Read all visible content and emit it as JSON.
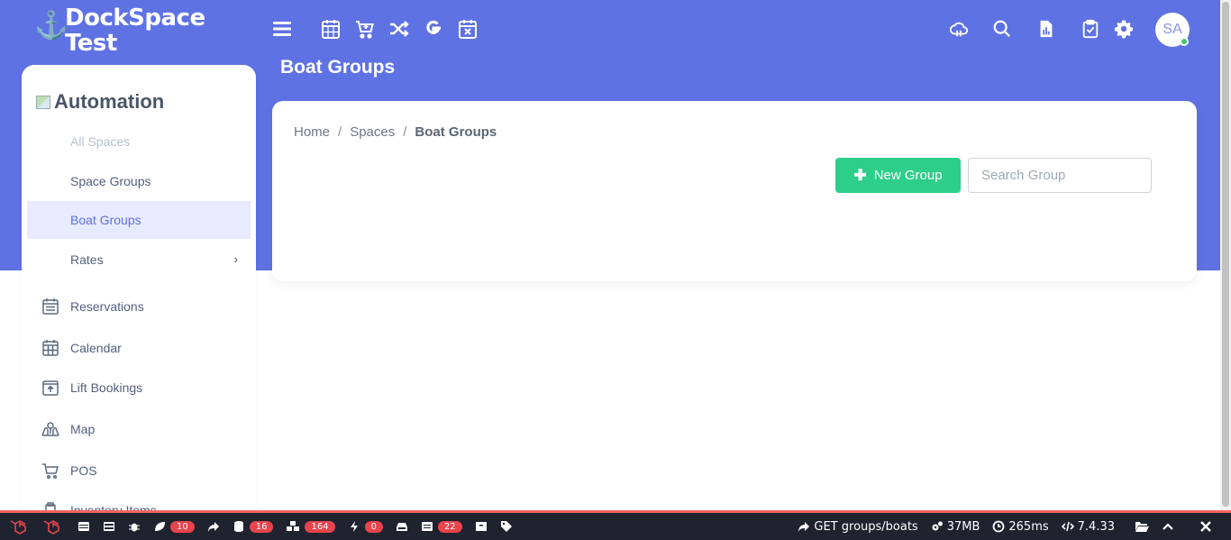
{
  "brand": {
    "line1": "DockSpace",
    "line2": "Test",
    "icon": "anchor-icon"
  },
  "toolbar": {
    "icons": [
      "menu-icon",
      "calendar-icon",
      "cart-icon",
      "shuffle-icon",
      "google-icon",
      "calendar-x-icon"
    ]
  },
  "header_right": {
    "icons": [
      "cloud-icon",
      "search-icon",
      "file-chart-icon",
      "clipboard-check-icon",
      "gear-icon"
    ],
    "avatar_initials": "SA"
  },
  "page": {
    "title": "Boat Groups"
  },
  "sidebar": {
    "heading": "Automation",
    "sub_items": [
      {
        "label": "All Spaces"
      },
      {
        "label": "Space Groups"
      },
      {
        "label": "Boat Groups"
      },
      {
        "label": "Rates"
      }
    ],
    "nav_items": [
      {
        "label": "Reservations",
        "icon": "reservations-icon"
      },
      {
        "label": "Calendar",
        "icon": "calendar-icon"
      },
      {
        "label": "Lift Bookings",
        "icon": "lift-icon"
      },
      {
        "label": "Map",
        "icon": "map-icon"
      },
      {
        "label": "POS",
        "icon": "cart-icon"
      },
      {
        "label": "Inventory Items",
        "icon": "inventory-icon"
      }
    ]
  },
  "breadcrumb": {
    "home": "Home",
    "spaces": "Spaces",
    "current": "Boat Groups",
    "separator": "/"
  },
  "actions": {
    "new_group_label": "New Group",
    "search_placeholder": "Search Group"
  },
  "debugbar": {
    "counts": {
      "messages": "10",
      "queries": "16",
      "models": "164",
      "events": "0",
      "views": "22"
    },
    "request": "GET groups/boats",
    "memory": "37MB",
    "time": "265ms",
    "version": "7.4.33",
    "colors": {
      "bar": "#1f2330",
      "accent": "#f4645f",
      "badge": "#e9444c"
    }
  },
  "colors": {
    "hero": "#5f72e4",
    "active_bg": "#e8eaff",
    "success": "#2dce89"
  }
}
